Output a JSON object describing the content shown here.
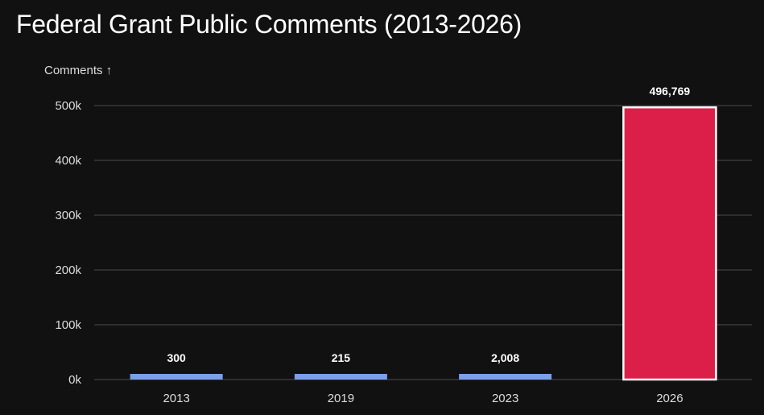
{
  "chart_data": {
    "type": "bar",
    "title": "Federal Grant Public Comments (2013-2026)",
    "ylabel": "Comments ↑",
    "xlabel": "",
    "categories": [
      "2013",
      "2019",
      "2023",
      "2026"
    ],
    "values": [
      300,
      215,
      2008,
      496769
    ],
    "value_labels": [
      "300",
      "215",
      "2,008",
      "496,769"
    ],
    "ylim": [
      0,
      500000
    ],
    "yticks": [
      0,
      100000,
      200000,
      300000,
      400000,
      500000
    ],
    "ytick_labels": [
      "0k",
      "100k",
      "200k",
      "300k",
      "400k",
      "500k"
    ],
    "grid": true,
    "legend": "none",
    "colors": {
      "default_bar": "#7b9fe8",
      "highlight_bar": "#dc1f48",
      "highlight_border": "#ffffff",
      "grid": "#4a4a4a",
      "background": "#111111",
      "text": "#ffffff",
      "tick_text": "#dddddd"
    },
    "highlight_index": 3
  }
}
